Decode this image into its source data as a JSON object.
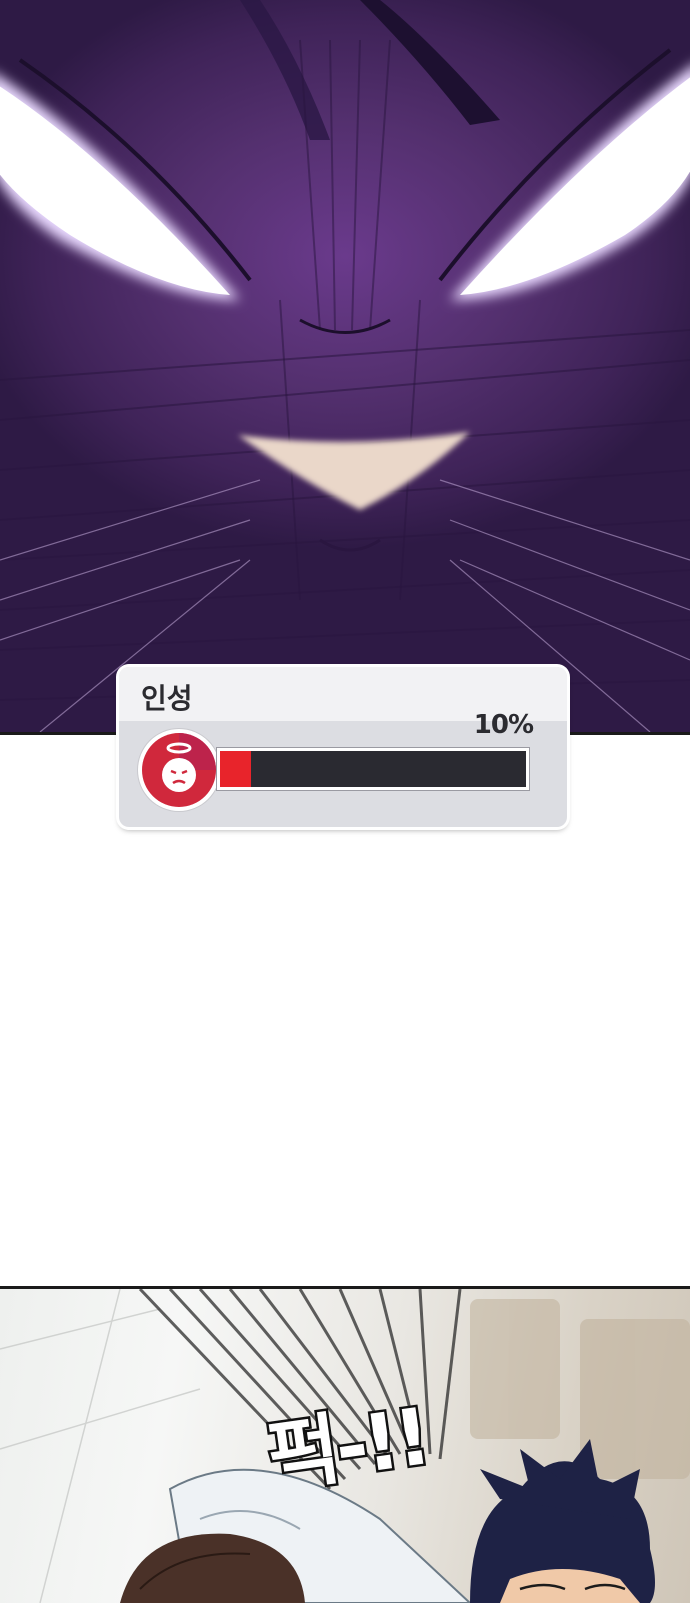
{
  "status_window": {
    "title": "인성",
    "percent_label": "10%",
    "level": 0.1,
    "icon": "angel-face-icon",
    "colors": {
      "fill": "#e8242b",
      "track": "#2a2a31",
      "icon_ring": "#d0283c"
    }
  },
  "sound_effect": "퍽-!!",
  "colors": {
    "face_purple": "#54306f",
    "eye_glow": "#ffffff"
  }
}
